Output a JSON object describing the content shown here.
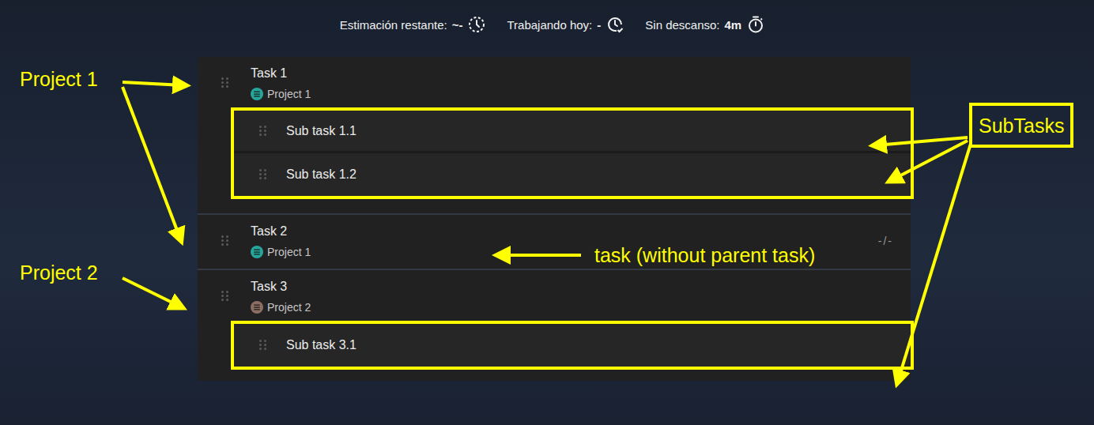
{
  "header": {
    "stats": [
      {
        "label": "Estimación restante:",
        "value": "~-"
      },
      {
        "label": "Trabajando hoy:",
        "value": "-"
      },
      {
        "label": "Sin descanso:",
        "value": "4m"
      }
    ]
  },
  "tasks": [
    {
      "title": "Task 1",
      "project": "Project 1",
      "color": "#26a69a",
      "subtasks": [
        {
          "title": "Sub task 1.1"
        },
        {
          "title": "Sub task 1.2"
        }
      ]
    },
    {
      "title": "Task 2",
      "project": "Project 1",
      "color": "#26a69a",
      "estimate": "-/-",
      "subtasks": []
    },
    {
      "title": "Task 3",
      "project": "Project 2",
      "color": "#8d6e63",
      "subtasks": [
        {
          "title": "Sub task 3.1"
        }
      ]
    }
  ],
  "annotations": {
    "project_1": "Project 1",
    "project_2": "Project 2",
    "subtasks": "SubTasks",
    "task": "task (without parent task)"
  }
}
